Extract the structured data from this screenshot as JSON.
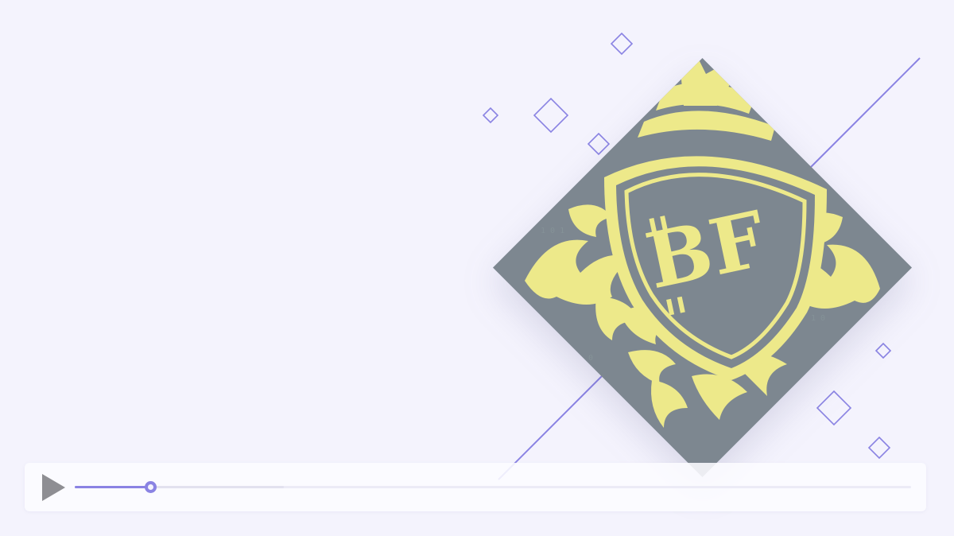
{
  "colors": {
    "background": "#f4f3fd",
    "accent": "#8a83e3",
    "emblem_dark": "#7d8790",
    "emblem_gold": "#ede98a"
  },
  "emblem": {
    "icon": "bitcoin-crest-logo",
    "monogram": "BF"
  },
  "player": {
    "play_icon": "play-icon",
    "progress_fraction": 0.09,
    "buffered_fraction": 0.25
  }
}
